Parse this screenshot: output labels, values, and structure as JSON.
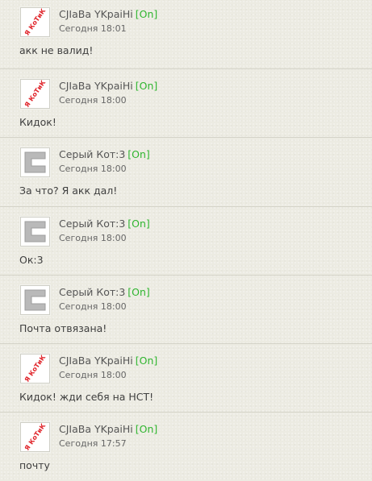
{
  "posts": [
    {
      "author": "CJIaBa YKpaiHi",
      "status": "[On]",
      "time": "Сегодня 18:01",
      "text": "акк не валид!",
      "avatar": "ya-kotik-avatar",
      "avatar_text": "Я КоТиК"
    },
    {
      "author": "CJIaBa YKpaiHi",
      "status": "[On]",
      "time": "Сегодня 18:00",
      "text": "Кидок!",
      "avatar": "ya-kotik-avatar",
      "avatar_text": "Я КоТиК"
    },
    {
      "author": "Серый Кот:3",
      "status": "[On]",
      "time": "Сегодня 18:00",
      "text": "За что? Я акк дал!",
      "avatar": "gray-c-avatar"
    },
    {
      "author": "Серый Кот:3",
      "status": "[On]",
      "time": "Сегодня 18:00",
      "text": "Ок:3",
      "avatar": "gray-c-avatar"
    },
    {
      "author": "Серый Кот:3",
      "status": "[On]",
      "time": "Сегодня 18:00",
      "text": "Почта отвязана!",
      "avatar": "gray-c-avatar"
    },
    {
      "author": "CJIaBa YKpaiHi",
      "status": "[On]",
      "time": "Сегодня 18:00",
      "text": "Кидок! жди себя на НСТ!",
      "avatar": "ya-kotik-avatar",
      "avatar_text": "Я КоТиК"
    },
    {
      "author": "CJIaBa YKpaiHi",
      "status": "[On]",
      "time": "Сегодня 17:57",
      "text": "почту",
      "avatar": "ya-kotik-avatar",
      "avatar_text": "Я КоТиК"
    }
  ],
  "colors": {
    "background": "#ecebe2",
    "status_online": "#2fb52f",
    "divider": "#d4d3c8",
    "avatar_red": "#e0242a",
    "avatar_gray": "#b9b9b9"
  }
}
